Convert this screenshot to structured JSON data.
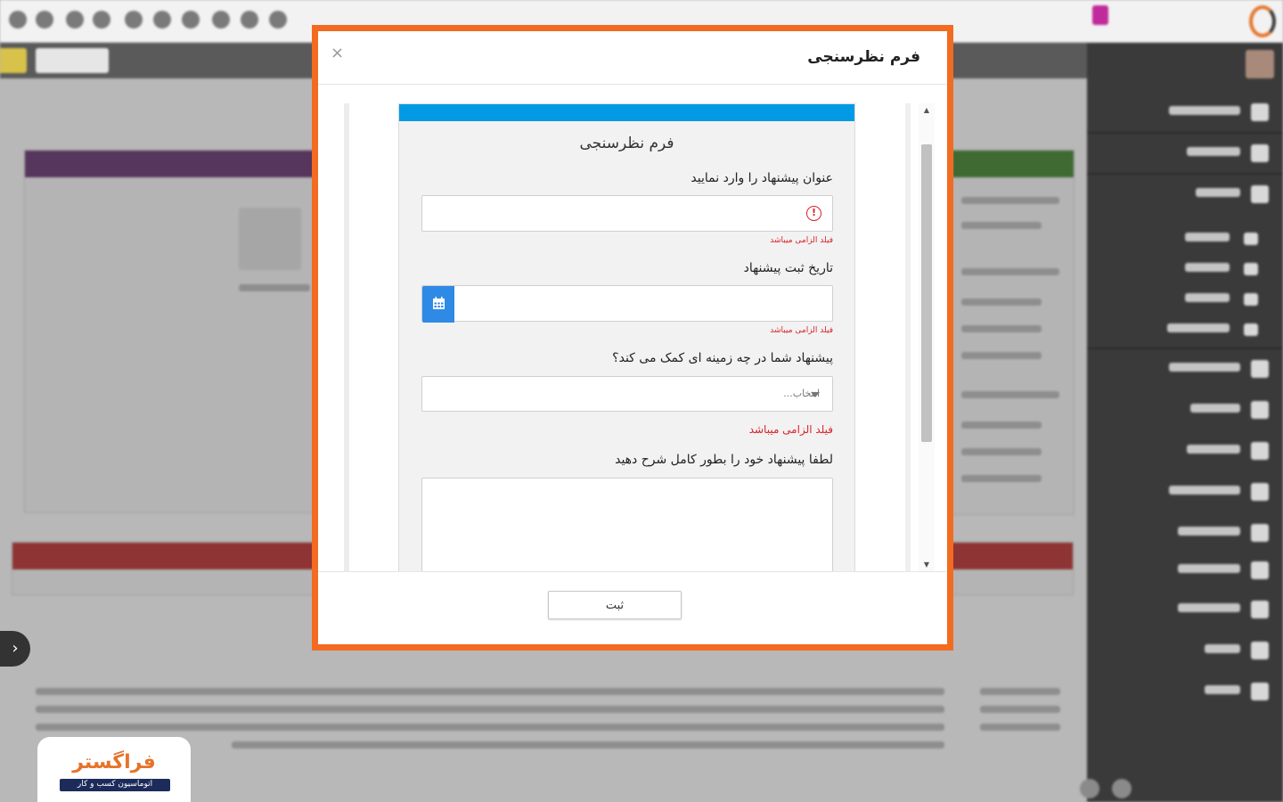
{
  "modal": {
    "title": "فرم نظرسنجی",
    "close_icon": "×",
    "submit_label": "ثبت"
  },
  "form": {
    "title": "فرم نظرسنجی",
    "fields": [
      {
        "label": "عنوان پیشنهاد را وارد نمایید",
        "value": "",
        "error": "فیلد الزامی میباشد"
      },
      {
        "label": "تاریخ ثبت پیشنهاد",
        "value": "",
        "error": "فیلد الزامی میباشد"
      },
      {
        "label": "پیشنهاد شما در چه زمینه ای کمک می کند؟",
        "placeholder": "انتخاب...",
        "error": "فیلد الزامی میباشد"
      },
      {
        "label": "لطفا پیشنهاد خود را بطور کامل شرح دهید",
        "value": ""
      }
    ]
  },
  "brand": {
    "name": "فراگستر",
    "tagline": "اتوماسیون کسب و کار"
  },
  "colors": {
    "modal_border": "#f26b21",
    "form_header": "#029ae4",
    "error": "#d9222a",
    "calendar_button": "#2f8ae5"
  }
}
